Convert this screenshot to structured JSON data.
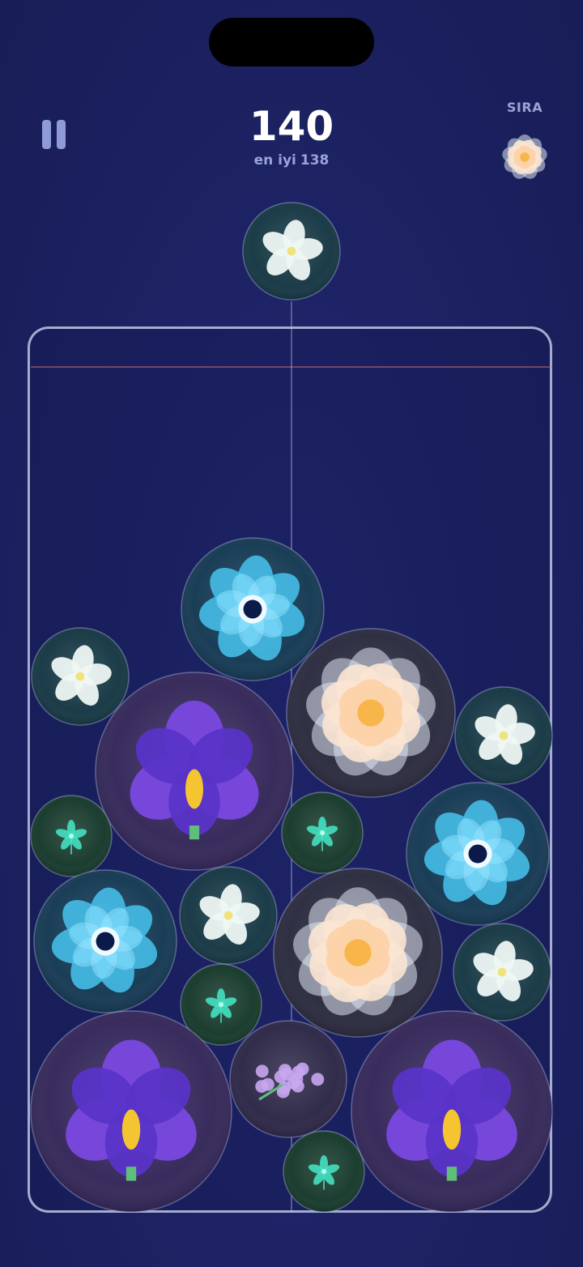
{
  "hud": {
    "score": "140",
    "best_label": "en iyi",
    "best_value": "138",
    "next_label": "SIRA"
  },
  "flower_types": {
    "lily": {
      "flower": "plumeria",
      "bubble": "#163844",
      "petal": "#eef7f4",
      "center": "#f2e27a"
    },
    "bud": {
      "flower": "green-bud",
      "bubble": "#173a2c",
      "petal": "#44e0c0",
      "center": "#b8fff0"
    },
    "hyacinth": {
      "flower": "hyacinth",
      "bubble": "#2e2848",
      "petal": "#c8a6f0",
      "center": "#e8d6ff"
    },
    "anemone": {
      "flower": "blue-anemone",
      "bubble": "#163a54",
      "petal": "#48c4f0",
      "center": "#0c1a4a"
    },
    "peony": {
      "flower": "peach-peony",
      "bubble": "#2c2c40",
      "petal": "#fbe4d2",
      "center": "#f8b64a"
    },
    "iris": {
      "flower": "purple-iris",
      "bubble": "#35285a",
      "petal": "#7a48e0",
      "center": "#f4c530"
    }
  },
  "next_flower": "peony",
  "current_flower": "lily",
  "board": [
    {
      "type": "anemone"
    },
    {
      "type": "lily"
    },
    {
      "type": "peony"
    },
    {
      "type": "iris"
    },
    {
      "type": "lily"
    },
    {
      "type": "bud"
    },
    {
      "type": "bud"
    },
    {
      "type": "anemone"
    },
    {
      "type": "anemone"
    },
    {
      "type": "lily"
    },
    {
      "type": "peony"
    },
    {
      "type": "lily"
    },
    {
      "type": "bud"
    },
    {
      "type": "iris"
    },
    {
      "type": "hyacinth"
    },
    {
      "type": "iris"
    },
    {
      "type": "bud"
    }
  ]
}
